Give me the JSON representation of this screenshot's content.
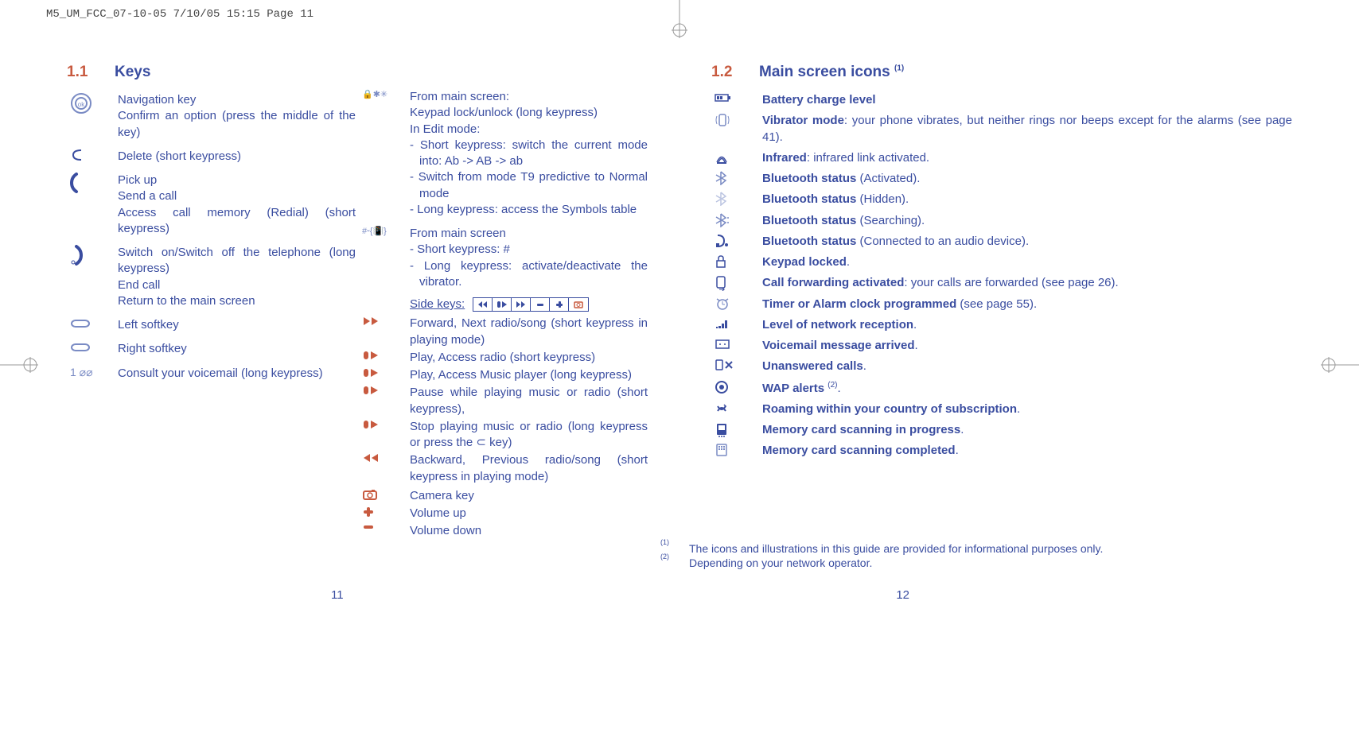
{
  "header": "M5_UM_FCC_07-10-05  7/10/05  15:15  Page 11",
  "page_number_left": "11",
  "page_number_right": "12",
  "left_page": {
    "section_number": "1.1",
    "section_title": "Keys",
    "col1": {
      "nav": {
        "line1": "Navigation key",
        "line2": "Confirm an option (press the middle of the key)"
      },
      "delete": "Delete (short keypress)",
      "pickup": {
        "l1": "Pick up",
        "l2": "Send a call",
        "l3": "Access call memory (Redial) (short keypress)"
      },
      "power": {
        "l1": "Switch on/Switch off the telephone (long keypress)",
        "l2": "End call",
        "l3": "Return to the main screen"
      },
      "left_softkey": "Left softkey",
      "right_softkey": "Right softkey",
      "voicemail": "Consult your voicemail (long keypress)"
    },
    "col2": {
      "lockstar": {
        "l1": "From main screen:",
        "l2": "Keypad lock/unlock (long keypress)",
        "l3": "In Edit mode:",
        "b1": "- Short keypress: switch the current mode into: Ab -> AB -> ab",
        "b2": "- Switch from mode T9 predictive to Normal mode",
        "b3": "- Long keypress: access the Symbols table"
      },
      "poundvib": {
        "l1": "From main screen",
        "b1": "- Short keypress: #",
        "b2": "- Long keypress: activate/deactivate the vibrator."
      },
      "sidekeys_label": "Side keys:",
      "fwd": "Forward, Next radio/song (short keypress in playing mode)",
      "play_radio": "Play, Access radio (short keypress)",
      "play_music": "Play, Access Music player (long keypress)",
      "pause": "Pause while playing music or radio (short keypress),",
      "stop": "Stop playing music or radio (long keypress or press the ⊂ key)",
      "back": "Backward, Previous radio/song (short keypress in playing mode)",
      "camera": "Camera key",
      "vol_up": "Volume up",
      "vol_down": "Volume down"
    }
  },
  "right_page": {
    "section_number": "1.2",
    "section_title": "Main screen icons ",
    "section_sup": "(1)",
    "rows": {
      "battery": "Battery charge level",
      "vibrator_b": "Vibrator mode",
      "vibrator_r": ": your phone vibrates, but neither rings nor beeps except for the alarms (see page 41).",
      "infrared_b": "Infrared",
      "infrared_r": ": infrared link activated.",
      "bt_act_b": "Bluetooth status",
      "bt_act_r": " (Activated).",
      "bt_hid_b": "Bluetooth status",
      "bt_hid_r": " (Hidden).",
      "bt_search_b": "Bluetooth status",
      "bt_search_r": " (Searching).",
      "bt_audio_b": "Bluetooth status",
      "bt_audio_r": " (Connected to an audio device).",
      "keypad_locked": "Keypad locked",
      "callfwd_b": "Call forwarding activated",
      "callfwd_r": ": your calls are forwarded (see page 26).",
      "alarm_b": "Timer or Alarm clock programmed",
      "alarm_r": " (see page 55).",
      "network": "Level of network reception",
      "voicemail": "Voicemail message arrived",
      "unanswered": "Unanswered calls",
      "wap_b": "WAP alerts ",
      "wap_sup": "(2)",
      "roaming": "Roaming within your country of subscription",
      "scan_prog": "Memory card scanning in progress",
      "scan_done": "Memory card scanning completed"
    }
  },
  "footnotes": {
    "f1_sup": "(1)",
    "f1": "The icons and illustrations in this guide are provided for informational purposes only.",
    "f2_sup": "(2)",
    "f2": "Depending on your network operator."
  }
}
